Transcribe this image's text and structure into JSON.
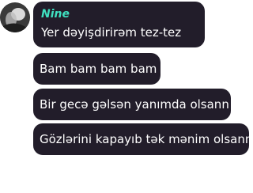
{
  "chat": {
    "sender_name": "Nine",
    "sender_color": "#3fe0c0",
    "bubble_color": "#221d2a",
    "avatar_icon": "user-avatar",
    "messages": [
      "Yer dəyişdirirəm tez-tez",
      "Bam bam bam bam",
      "Bir gecə gəlsən yanımda olsann",
      "Gözlərini kapayıb tək mənim olsann"
    ]
  }
}
